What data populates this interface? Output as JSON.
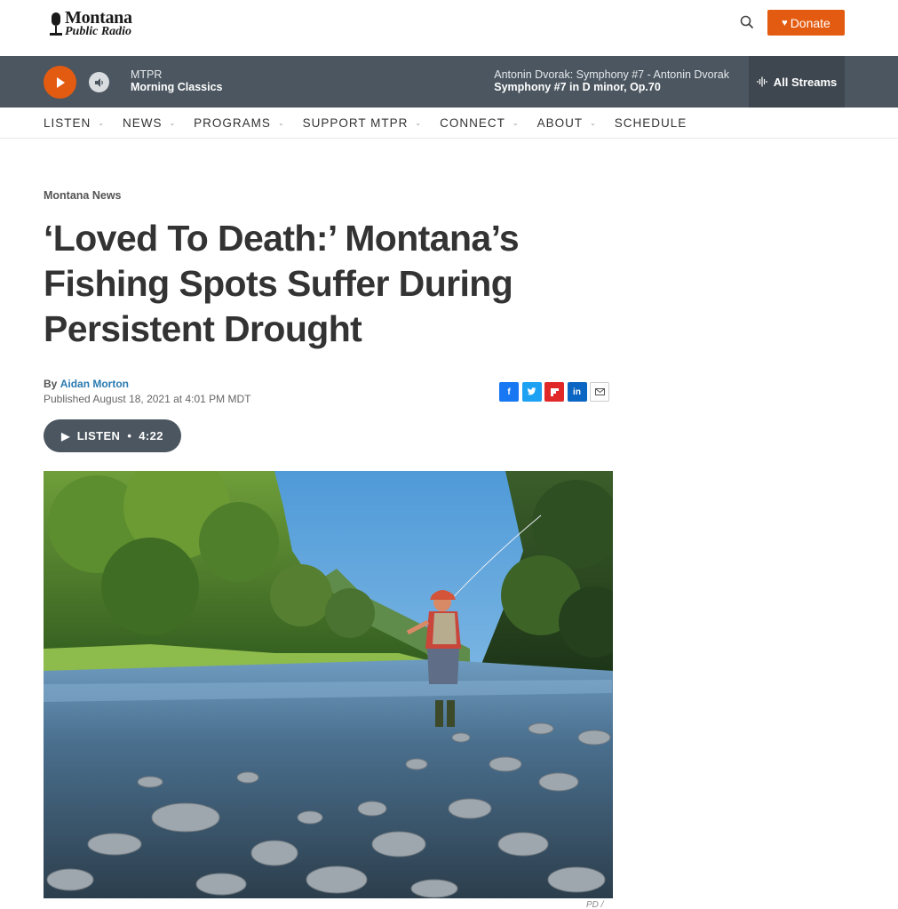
{
  "header": {
    "logo_line1": "Montana",
    "logo_line2": "Public Radio",
    "search_icon": "search-icon",
    "donate_label": "Donate",
    "brand_color": "#e35b10"
  },
  "player": {
    "station": "MTPR",
    "show": "Morning Classics",
    "piece": "Antonin Dvorak: Symphony #7 - Antonin Dvorak",
    "title": "Symphony #7 in D minor, Op.70",
    "all_streams": "All Streams",
    "bar_color": "#4b5660"
  },
  "nav": {
    "items": [
      {
        "label": "LISTEN",
        "dropdown": true
      },
      {
        "label": "NEWS",
        "dropdown": true
      },
      {
        "label": "PROGRAMS",
        "dropdown": true
      },
      {
        "label": "SUPPORT MTPR",
        "dropdown": true
      },
      {
        "label": "CONNECT",
        "dropdown": true
      },
      {
        "label": "ABOUT",
        "dropdown": true
      },
      {
        "label": "SCHEDULE",
        "dropdown": false
      }
    ]
  },
  "article": {
    "category": "Montana News",
    "headline": "‘Loved To Death:’ Montana’s Fishing Spots Suffer During Persistent Drought",
    "by": "By",
    "author": "Aidan Morton",
    "published": "Published August 18, 2021 at 4:01 PM MDT",
    "share": [
      "facebook-icon",
      "twitter-icon",
      "flipboard-icon",
      "linkedin-icon",
      "email-icon"
    ],
    "listen_label": "LISTEN",
    "listen_duration": "4:22",
    "photo_credit": "PD /"
  }
}
